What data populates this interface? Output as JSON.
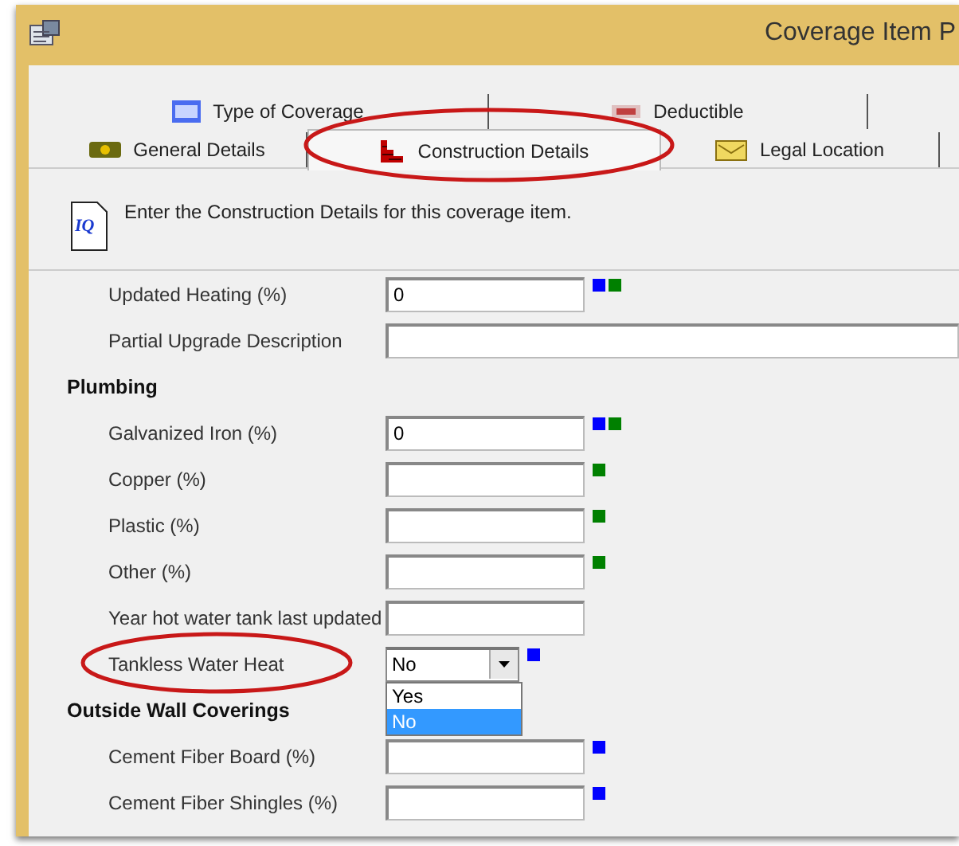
{
  "window": {
    "title": "Coverage Item P"
  },
  "tabs_back": [
    {
      "label": "Type of Coverage",
      "selected": false
    },
    {
      "label": "Deductible",
      "selected": false
    }
  ],
  "tabs_front": [
    {
      "label": "General Details",
      "selected": false,
      "circled": false
    },
    {
      "label": "Construction Details",
      "selected": true,
      "circled": true
    },
    {
      "label": "Legal Location",
      "selected": false,
      "circled": false
    }
  ],
  "header": {
    "logo": "IQ",
    "text": "Enter the Construction Details for this coverage item."
  },
  "form": [
    {
      "kind": "field",
      "label": "Updated Heating (%)",
      "value": "0",
      "markers": [
        {
          "color": "#0000ff"
        },
        {
          "color": "#008000"
        }
      ]
    },
    {
      "kind": "wide-field",
      "label": "Partial Upgrade Description"
    },
    {
      "kind": "heading",
      "label": "Plumbing"
    },
    {
      "kind": "field",
      "label": "Galvanized Iron (%)",
      "value": "0",
      "markers": [
        {
          "color": "#0000ff"
        },
        {
          "color": "#008000"
        }
      ]
    },
    {
      "kind": "field",
      "label": "Copper (%)",
      "markers": [
        {
          "color": "#008000"
        }
      ]
    },
    {
      "kind": "field",
      "label": "Plastic (%)",
      "markers": [
        {
          "color": "#008000"
        }
      ]
    },
    {
      "kind": "field",
      "label": "Other (%)",
      "markers": [
        {
          "color": "#008000"
        }
      ]
    },
    {
      "kind": "field",
      "label": "Year hot water tank last updated"
    },
    {
      "kind": "select",
      "label": "Tankless Water Heat",
      "value": "No",
      "circled": true,
      "open": true,
      "options": [
        {
          "label": "Yes",
          "selected": false
        },
        {
          "label": "No",
          "selected": true
        }
      ],
      "markers": [
        {
          "color": "#0000ff"
        }
      ]
    },
    {
      "kind": "heading",
      "label": "Outside Wall Coverings"
    },
    {
      "kind": "field",
      "label": "Cement Fiber Board (%)",
      "markers": [
        {
          "color": "#0000ff"
        }
      ]
    },
    {
      "kind": "field",
      "label": "Cement Fiber Shingles (%)",
      "markers": [
        {
          "color": "#0000ff"
        }
      ]
    }
  ]
}
